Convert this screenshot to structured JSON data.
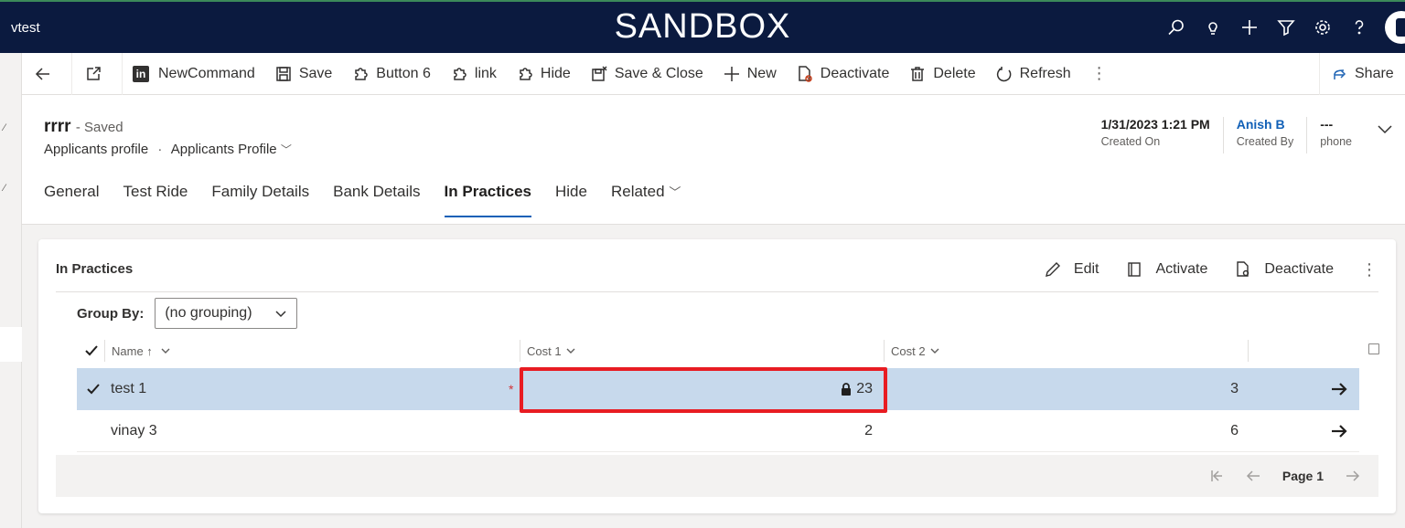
{
  "topbar": {
    "app_name": "vtest",
    "environment_title": "SANDBOX",
    "icons": [
      "search-icon",
      "lightbulb-icon",
      "plus-icon",
      "filter-icon",
      "gear-icon",
      "help-icon"
    ]
  },
  "commands": {
    "back_icon": "back-arrow-icon",
    "popout_icon": "open-new-window-icon",
    "new_command": "NewCommand",
    "save": "Save",
    "button6": "Button 6",
    "link": "link",
    "hide": "Hide",
    "save_close": "Save & Close",
    "new": "New",
    "deactivate": "Deactivate",
    "delete": "Delete",
    "refresh": "Refresh",
    "share": "Share"
  },
  "record": {
    "title": "rrrr",
    "status": "- Saved",
    "entity": "Applicants profile",
    "form": "Applicants Profile",
    "header_fields": [
      {
        "value": "1/31/2023 1:21 PM",
        "label": "Created On"
      },
      {
        "value": "Anish B",
        "label": "Created By"
      },
      {
        "value": "---",
        "label": "phone"
      }
    ]
  },
  "tabs": [
    {
      "label": "General",
      "active": false
    },
    {
      "label": "Test Ride",
      "active": false
    },
    {
      "label": "Family Details",
      "active": false
    },
    {
      "label": "Bank Details",
      "active": false
    },
    {
      "label": "In Practices",
      "active": true
    },
    {
      "label": "Hide",
      "active": false
    },
    {
      "label": "Related",
      "active": false
    }
  ],
  "subgrid": {
    "title": "In Practices",
    "actions": {
      "edit": "Edit",
      "activate": "Activate",
      "deactivate": "Deactivate"
    },
    "group_by_label": "Group By:",
    "group_by_value": "(no grouping)",
    "columns": {
      "name": "Name ↑",
      "cost1": "Cost 1",
      "cost2": "Cost 2"
    },
    "rows": [
      {
        "name": "test 1",
        "cost1": "23",
        "cost2": "3",
        "selected": true,
        "cost1_locked": true
      },
      {
        "name": "vinay 3",
        "cost1": "2",
        "cost2": "6",
        "selected": false,
        "cost1_locked": false
      }
    ],
    "pager": {
      "page_label": "Page 1"
    }
  },
  "colors": {
    "topbar_bg": "#0b1a3f",
    "selected_row": "#c7d9ec",
    "highlight": "#e81c22",
    "link": "#1160b7"
  }
}
